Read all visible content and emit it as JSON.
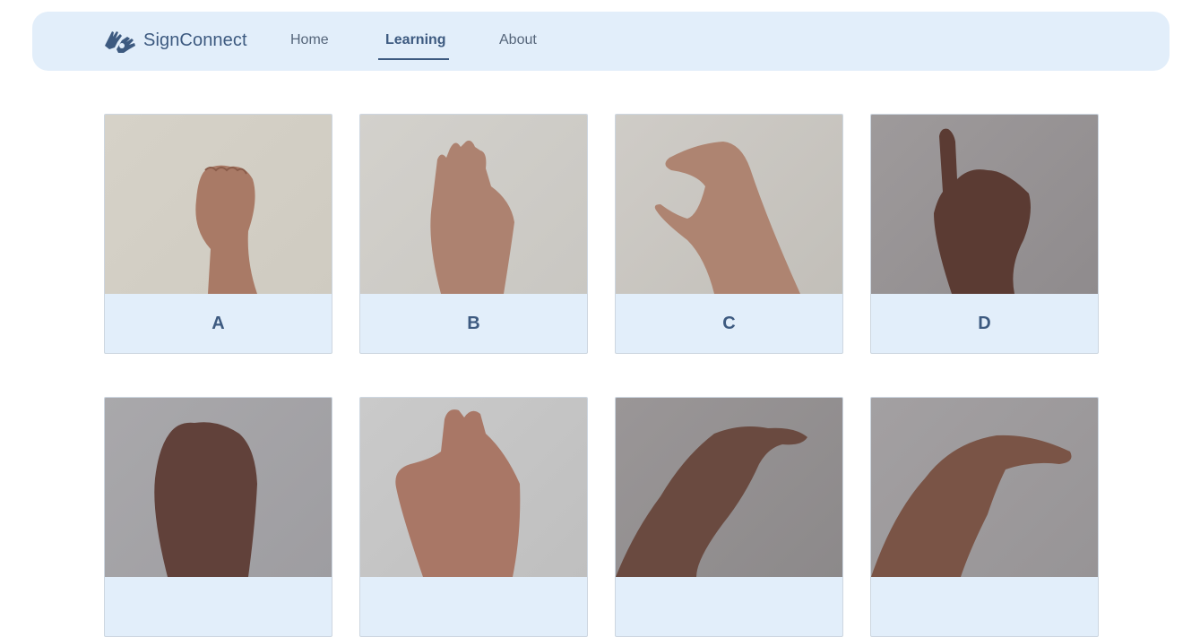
{
  "navbar": {
    "brand_name": "SignConnect",
    "logo_icon": "sign-language-hands-icon",
    "links": {
      "home": "Home",
      "learning": "Learning",
      "about": "About"
    },
    "active": "learning"
  },
  "cards": [
    {
      "letter": "A"
    },
    {
      "letter": "B"
    },
    {
      "letter": "C"
    },
    {
      "letter": "D"
    },
    {
      "letter": ""
    },
    {
      "letter": ""
    },
    {
      "letter": ""
    },
    {
      "letter": ""
    }
  ],
  "colors": {
    "navbar_bg": "#e2eefa",
    "accent": "#3d5a80",
    "card_label_bg": "#e2eefa",
    "skin": "#a97a66"
  }
}
